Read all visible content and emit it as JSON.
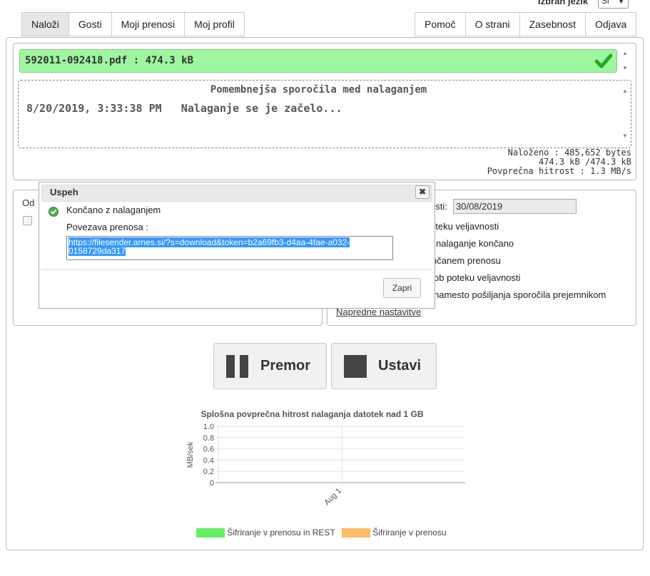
{
  "language": {
    "label": "Izbran jezik",
    "selected": "Sl"
  },
  "tabs_left": [
    {
      "label": "Naloži",
      "active": true
    },
    {
      "label": "Gosti",
      "active": false
    },
    {
      "label": "Moji prenosi",
      "active": false
    },
    {
      "label": "Moj profil",
      "active": false
    }
  ],
  "tabs_right": [
    {
      "label": "Pomoč"
    },
    {
      "label": "O strani"
    },
    {
      "label": "Zasebnost"
    },
    {
      "label": "Odjava"
    }
  ],
  "upload": {
    "file_line": "592011-092418.pdf : 474.3 kB",
    "messages_title": "Pomembnejša sporočila med nalaganjem",
    "message_time": "8/20/2019, 3:33:38 PM",
    "message_text": "Nalaganje se je začelo...",
    "stat_uploaded": "Naloženo : 485,652 bytes",
    "stat_size": "474.3 kB /474.3 kB",
    "stat_speed": "Povprečna hitrost : 1.3 MB/s"
  },
  "options": {
    "left_label": "Od",
    "expiry_label": "psti:",
    "expiry_date": "30/08/2019",
    "lines": [
      "oteku veljavnosti",
      "nalaganje končano",
      "nčanem prenosu",
      "ob poteku veljavnosti",
      "namesto pošiljanja sporočila prejemnikom"
    ],
    "advanced_link": "Napredne nastavitve"
  },
  "dialog": {
    "title": "Uspeh",
    "close_symbol": "✖",
    "done_text": "Končano z nalaganjem",
    "link_label": "Povezava prenosa :",
    "link_line1": "https://filesender.arnes.si/?s=download&token=b2a69fb3-d4aa-4fae-a032-",
    "link_line2": "0158729da317",
    "close_button": "Zapri"
  },
  "actions": {
    "pause": "Premor",
    "stop": "Ustavi"
  },
  "colors": {
    "success_bar": "#9ef79e",
    "check": "#22aa22",
    "legend_green": "#66ee66",
    "legend_orange": "#ffbb66"
  },
  "chart_data": {
    "type": "line",
    "title": "Splošna povprečna hitrost nalaganja datotek nad 1 GB",
    "ylabel": "MB/sek",
    "xlabel": "",
    "x": [
      "Aug 1"
    ],
    "yticks": [
      "1.0",
      "0.8",
      "0.6",
      "0.4",
      "0.2",
      "0"
    ],
    "ylim": [
      0,
      1.0
    ],
    "grid": true,
    "legend_position": "bottom",
    "series": [
      {
        "name": "Šifriranje v prenosu in REST",
        "color": "#66ee66",
        "values": []
      },
      {
        "name": "Šifriranje v prenosu",
        "color": "#ffbb66",
        "values": []
      }
    ]
  }
}
